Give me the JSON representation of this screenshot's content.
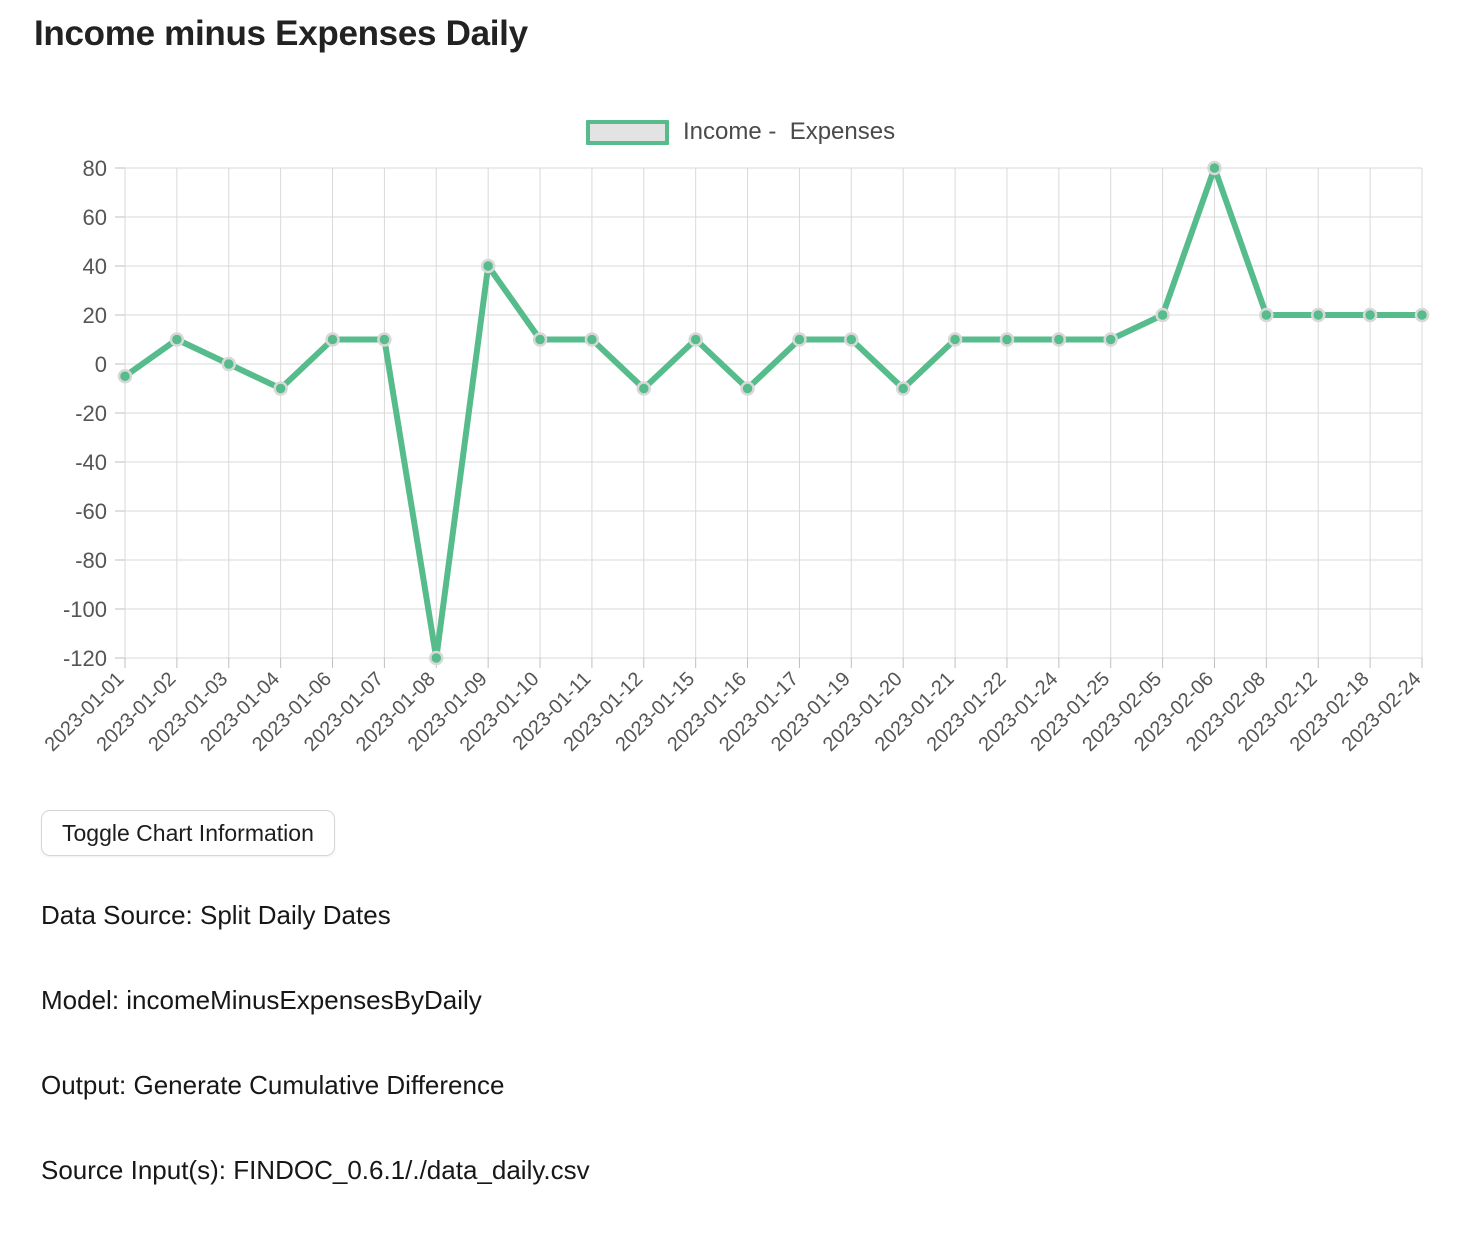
{
  "page": {
    "title": "Income minus Expenses Daily"
  },
  "legend": {
    "swatch_fill": "#e3e3e3",
    "swatch_border": "#57bc8c",
    "label": "Income -  Expenses"
  },
  "toolbar": {
    "toggle_label": "Toggle Chart Information"
  },
  "info": {
    "lines": [
      "Data Source: Split Daily Dates",
      "Model: incomeMinusExpensesByDaily",
      "Output: Generate Cumulative Difference",
      "Source Input(s): FINDOC_0.6.1/./data_daily.csv"
    ]
  },
  "chart_data": {
    "type": "line",
    "title": "Income minus Expenses Daily",
    "xlabel": "",
    "ylabel": "",
    "ylim": [
      -120,
      80
    ],
    "yticks": [
      80,
      60,
      40,
      20,
      0,
      -20,
      -40,
      -60,
      -80,
      -100,
      -120
    ],
    "grid": true,
    "legend_position": "top-center",
    "line_color": "#57bc8c",
    "marker_fill": "#57bc8c",
    "marker_stroke": "#d8d8d8",
    "categories": [
      "2023-01-01",
      "2023-01-02",
      "2023-01-03",
      "2023-01-04",
      "2023-01-06",
      "2023-01-07",
      "2023-01-08",
      "2023-01-09",
      "2023-01-10",
      "2023-01-11",
      "2023-01-12",
      "2023-01-15",
      "2023-01-16",
      "2023-01-17",
      "2023-01-19",
      "2023-01-20",
      "2023-01-21",
      "2023-01-22",
      "2023-01-24",
      "2023-01-25",
      "2023-02-05",
      "2023-02-06",
      "2023-02-08",
      "2023-02-12",
      "2023-02-18",
      "2023-02-24"
    ],
    "series": [
      {
        "name": "Income -  Expenses",
        "values": [
          -5,
          10,
          0,
          -10,
          10,
          10,
          -120,
          40,
          10,
          10,
          -10,
          10,
          -10,
          10,
          10,
          -10,
          10,
          10,
          10,
          10,
          20,
          80,
          20,
          20,
          20,
          20
        ]
      }
    ]
  }
}
